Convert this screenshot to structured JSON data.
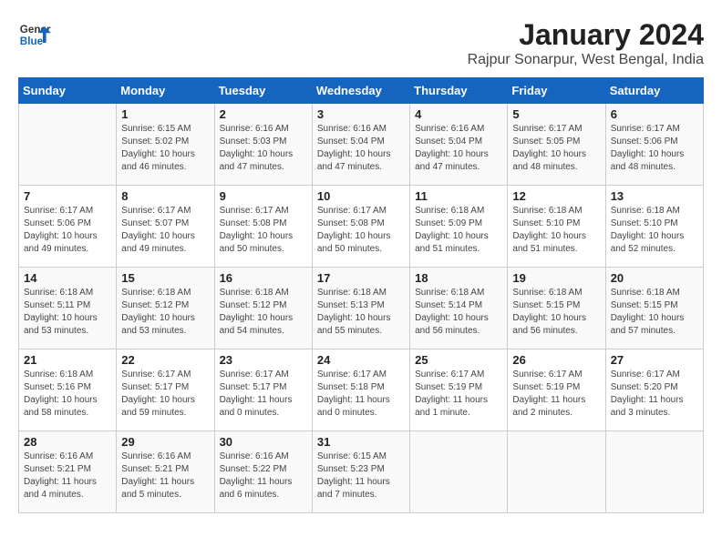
{
  "logo": {
    "line1": "General",
    "line2": "Blue"
  },
  "title": "January 2024",
  "subtitle": "Rajpur Sonarpur, West Bengal, India",
  "days_of_week": [
    "Sunday",
    "Monday",
    "Tuesday",
    "Wednesday",
    "Thursday",
    "Friday",
    "Saturday"
  ],
  "weeks": [
    [
      {
        "day": "",
        "info": ""
      },
      {
        "day": "1",
        "info": "Sunrise: 6:15 AM\nSunset: 5:02 PM\nDaylight: 10 hours\nand 46 minutes."
      },
      {
        "day": "2",
        "info": "Sunrise: 6:16 AM\nSunset: 5:03 PM\nDaylight: 10 hours\nand 47 minutes."
      },
      {
        "day": "3",
        "info": "Sunrise: 6:16 AM\nSunset: 5:04 PM\nDaylight: 10 hours\nand 47 minutes."
      },
      {
        "day": "4",
        "info": "Sunrise: 6:16 AM\nSunset: 5:04 PM\nDaylight: 10 hours\nand 47 minutes."
      },
      {
        "day": "5",
        "info": "Sunrise: 6:17 AM\nSunset: 5:05 PM\nDaylight: 10 hours\nand 48 minutes."
      },
      {
        "day": "6",
        "info": "Sunrise: 6:17 AM\nSunset: 5:06 PM\nDaylight: 10 hours\nand 48 minutes."
      }
    ],
    [
      {
        "day": "7",
        "info": "Sunrise: 6:17 AM\nSunset: 5:06 PM\nDaylight: 10 hours\nand 49 minutes."
      },
      {
        "day": "8",
        "info": "Sunrise: 6:17 AM\nSunset: 5:07 PM\nDaylight: 10 hours\nand 49 minutes."
      },
      {
        "day": "9",
        "info": "Sunrise: 6:17 AM\nSunset: 5:08 PM\nDaylight: 10 hours\nand 50 minutes."
      },
      {
        "day": "10",
        "info": "Sunrise: 6:17 AM\nSunset: 5:08 PM\nDaylight: 10 hours\nand 50 minutes."
      },
      {
        "day": "11",
        "info": "Sunrise: 6:18 AM\nSunset: 5:09 PM\nDaylight: 10 hours\nand 51 minutes."
      },
      {
        "day": "12",
        "info": "Sunrise: 6:18 AM\nSunset: 5:10 PM\nDaylight: 10 hours\nand 51 minutes."
      },
      {
        "day": "13",
        "info": "Sunrise: 6:18 AM\nSunset: 5:10 PM\nDaylight: 10 hours\nand 52 minutes."
      }
    ],
    [
      {
        "day": "14",
        "info": "Sunrise: 6:18 AM\nSunset: 5:11 PM\nDaylight: 10 hours\nand 53 minutes."
      },
      {
        "day": "15",
        "info": "Sunrise: 6:18 AM\nSunset: 5:12 PM\nDaylight: 10 hours\nand 53 minutes."
      },
      {
        "day": "16",
        "info": "Sunrise: 6:18 AM\nSunset: 5:12 PM\nDaylight: 10 hours\nand 54 minutes."
      },
      {
        "day": "17",
        "info": "Sunrise: 6:18 AM\nSunset: 5:13 PM\nDaylight: 10 hours\nand 55 minutes."
      },
      {
        "day": "18",
        "info": "Sunrise: 6:18 AM\nSunset: 5:14 PM\nDaylight: 10 hours\nand 56 minutes."
      },
      {
        "day": "19",
        "info": "Sunrise: 6:18 AM\nSunset: 5:15 PM\nDaylight: 10 hours\nand 56 minutes."
      },
      {
        "day": "20",
        "info": "Sunrise: 6:18 AM\nSunset: 5:15 PM\nDaylight: 10 hours\nand 57 minutes."
      }
    ],
    [
      {
        "day": "21",
        "info": "Sunrise: 6:18 AM\nSunset: 5:16 PM\nDaylight: 10 hours\nand 58 minutes."
      },
      {
        "day": "22",
        "info": "Sunrise: 6:17 AM\nSunset: 5:17 PM\nDaylight: 10 hours\nand 59 minutes."
      },
      {
        "day": "23",
        "info": "Sunrise: 6:17 AM\nSunset: 5:17 PM\nDaylight: 11 hours\nand 0 minutes."
      },
      {
        "day": "24",
        "info": "Sunrise: 6:17 AM\nSunset: 5:18 PM\nDaylight: 11 hours\nand 0 minutes."
      },
      {
        "day": "25",
        "info": "Sunrise: 6:17 AM\nSunset: 5:19 PM\nDaylight: 11 hours\nand 1 minute."
      },
      {
        "day": "26",
        "info": "Sunrise: 6:17 AM\nSunset: 5:19 PM\nDaylight: 11 hours\nand 2 minutes."
      },
      {
        "day": "27",
        "info": "Sunrise: 6:17 AM\nSunset: 5:20 PM\nDaylight: 11 hours\nand 3 minutes."
      }
    ],
    [
      {
        "day": "28",
        "info": "Sunrise: 6:16 AM\nSunset: 5:21 PM\nDaylight: 11 hours\nand 4 minutes."
      },
      {
        "day": "29",
        "info": "Sunrise: 6:16 AM\nSunset: 5:21 PM\nDaylight: 11 hours\nand 5 minutes."
      },
      {
        "day": "30",
        "info": "Sunrise: 6:16 AM\nSunset: 5:22 PM\nDaylight: 11 hours\nand 6 minutes."
      },
      {
        "day": "31",
        "info": "Sunrise: 6:15 AM\nSunset: 5:23 PM\nDaylight: 11 hours\nand 7 minutes."
      },
      {
        "day": "",
        "info": ""
      },
      {
        "day": "",
        "info": ""
      },
      {
        "day": "",
        "info": ""
      }
    ]
  ]
}
